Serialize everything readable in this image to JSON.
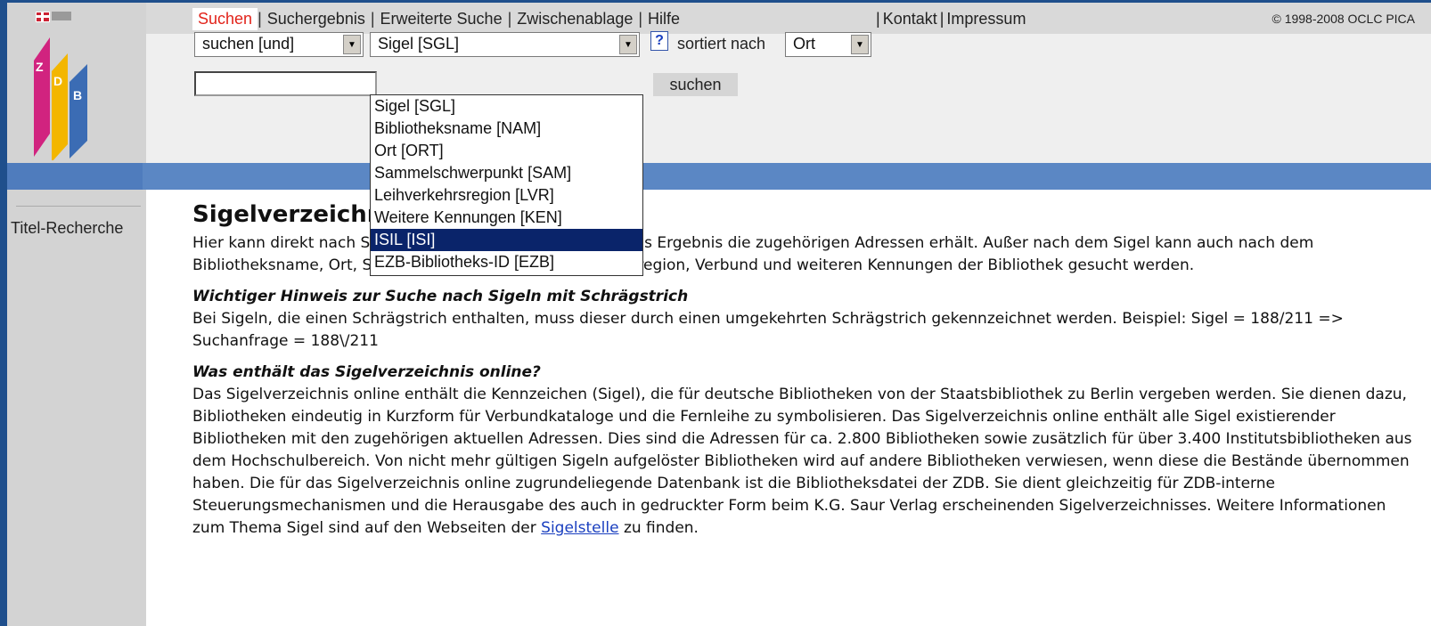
{
  "nav": {
    "items": [
      "Suchen",
      "Suchergebnis",
      "Erweiterte Suche",
      "Zwischenablage",
      "Hilfe"
    ],
    "items_right": [
      "Kontakt",
      "Impressum"
    ],
    "copyright": "© 1998-2008 OCLC PICA"
  },
  "search": {
    "operator_select": "suchen [und]",
    "field_select": "Sigel [SGL]",
    "help_label": "?",
    "sort_label": "sortiert nach",
    "sort_select": "Ort",
    "query_value": "",
    "button": "suchen",
    "dropdown_options": [
      "Sigel [SGL]",
      "Bibliotheksname [NAM]",
      "Ort [ORT]",
      "Sammelschwerpunkt [SAM]",
      "Leihverkehrsregion [LVR]",
      "Weitere Kennungen [KEN]",
      "ISIL [ISI]",
      "EZB-Bibliotheks-ID [EZB]"
    ],
    "highlighted_option": "ISIL [ISI]"
  },
  "sidebar": {
    "link": "Titel-Recherche"
  },
  "content": {
    "title": "Sigelverzeichnis online",
    "intro": "Hier kann direkt nach Sigeln gesucht werden, wobei man als Ergebnis die zugehörigen Adressen erhält. Außer nach dem Sigel kann auch nach dem Bibliotheksname, Ort, Sammelschwerpunkte, Leihverkehrsregion, Verbund und weiteren Kennungen der Bibliothek gesucht werden.",
    "heading1": "Wichtiger Hinweis zur Suche nach Sigeln mit Schrägstrich",
    "para1": "Bei Sigeln, die einen Schrägstrich enthalten, muss dieser durch einen umgekehrten Schrägstrich gekennzeichnet werden. Beispiel: Sigel = 188/211 => Suchanfrage = 188\\/211",
    "heading2": "Was enthält das Sigelverzeichnis online?",
    "para2": "Das Sigelverzeichnis online enthält die Kennzeichen (Sigel), die für deutsche Bibliotheken von der Staatsbibliothek zu Berlin vergeben werden. Sie dienen dazu, Bibliotheken eindeutig in Kurzform für Verbundkataloge und die Fernleihe zu symbolisieren. Das Sigelverzeichnis online enthält alle Sigel existierender Bibliotheken mit den zugehörigen aktuellen Adressen. Dies sind die Adressen für ca. 2.800 Bibliotheken sowie zusätzlich für über 3.400 Institutsbibliotheken aus dem Hochschulbereich. Von nicht mehr gültigen Sigeln aufgelöster Bibliotheken wird auf andere Bibliotheken verwiesen, wenn diese die Bestände übernommen haben. Die für das Sigelverzeichnis online zugrundeliegende Datenbank ist die Bibliotheksdatei der ZDB. Sie dient gleichzeitig für ZDB-interne Steuerungsmechanismen und die Herausgabe des auch in gedruckter Form beim K.G. Saur Verlag erscheinenden Sigelverzeichnisses. Weitere Informationen zum Thema Sigel sind auf den Webseiten der",
    "link": "Sigelstelle",
    "para2_end": "zu finden."
  },
  "colors": {
    "accent": "#e2231a",
    "bar": "#5b87c4",
    "selection": "#0a246a"
  }
}
